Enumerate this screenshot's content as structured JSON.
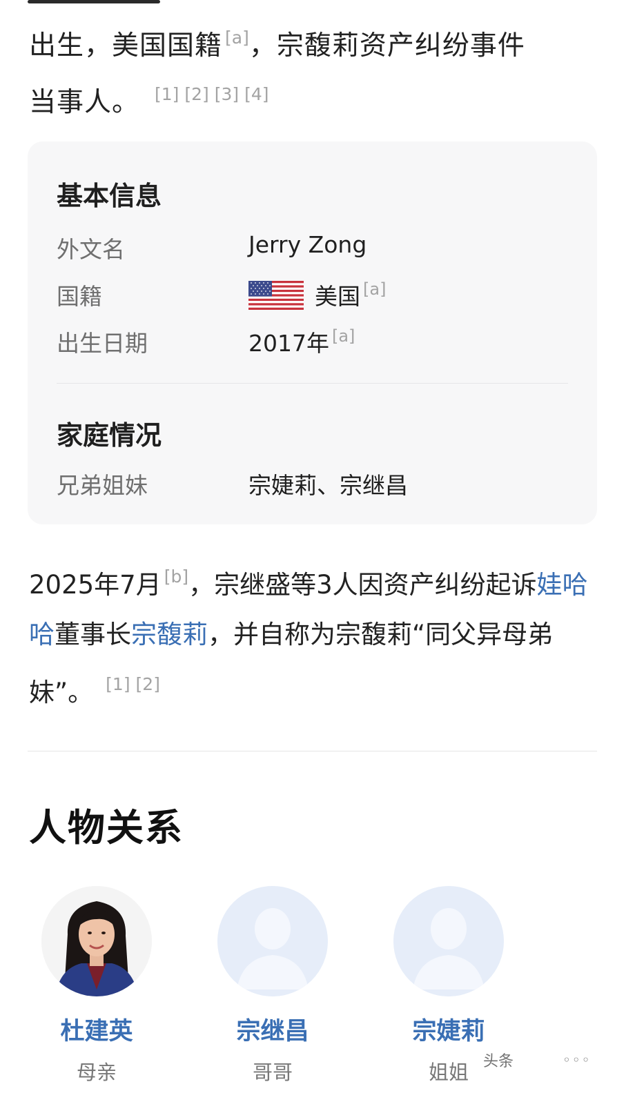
{
  "intro": {
    "line1": "出生，美国国籍",
    "ref_a": "[a]",
    "line1_tail": "，宗馥莉资产纠纷事件",
    "line2": "当事人。",
    "refs": "[1] [2] [3] [4]"
  },
  "infobox": {
    "basic_heading": "基本信息",
    "rows": [
      {
        "label": "外文名",
        "value": "Jerry Zong",
        "ref": ""
      },
      {
        "label": "国籍",
        "value": "美国",
        "ref": "[a]",
        "flag": "us-flag-icon"
      },
      {
        "label": "出生日期",
        "value": "2017年",
        "ref": "[a]"
      }
    ],
    "family_heading": "家庭情况",
    "family_rows": [
      {
        "label": "兄弟姐妹",
        "value": "宗婕莉、宗继昌"
      }
    ]
  },
  "paragraph": {
    "part1": "2025年7月",
    "ref_b": "[b]",
    "part2": "，宗继盛等3人因资产纠纷起诉",
    "link1": "娃哈哈",
    "part3": "董事长",
    "link2": "宗馥莉",
    "part4": "，并自称为宗馥莉“同父异母弟妹”。",
    "refs": "[1] [2]"
  },
  "relations": {
    "title": "人物关系",
    "people": [
      {
        "name": "杜建英",
        "relation": "母亲",
        "avatar": "photo-avatar"
      },
      {
        "name": "宗继昌",
        "relation": "哥哥",
        "avatar": "default-avatar-icon"
      },
      {
        "name": "宗婕莉",
        "relation": "姐姐",
        "avatar": "default-avatar-icon"
      }
    ]
  },
  "watermark": {
    "text": "头条",
    "dots": "◦◦◦"
  },
  "colors": {
    "link": "#3a6fb4",
    "card_bg": "#f7f7f8",
    "muted": "#6f6f6f"
  }
}
